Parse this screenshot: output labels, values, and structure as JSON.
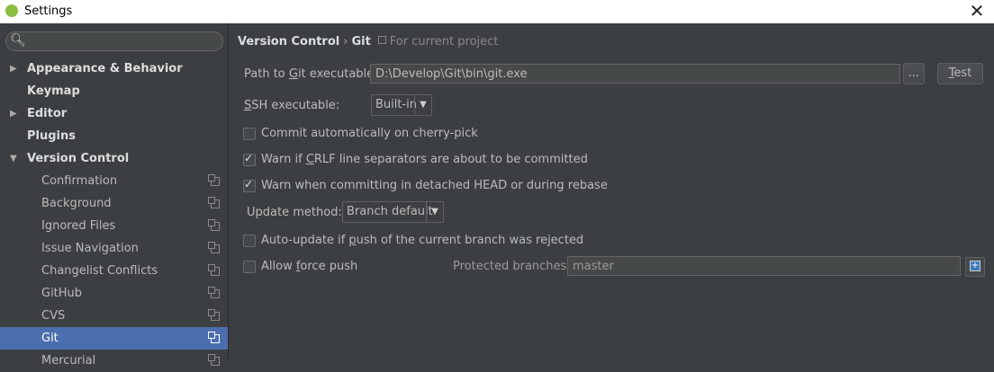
{
  "window": {
    "title": "Settings"
  },
  "sidebar": {
    "search_placeholder": "",
    "items": [
      {
        "label": "Appearance & Behavior",
        "arrow": "▶"
      },
      {
        "label": "Keymap",
        "arrow": ""
      },
      {
        "label": "Editor",
        "arrow": "▶"
      },
      {
        "label": "Plugins",
        "arrow": ""
      },
      {
        "label": "Version Control",
        "arrow": "▼"
      },
      {
        "label": "Confirmation"
      },
      {
        "label": "Background"
      },
      {
        "label": "Ignored Files"
      },
      {
        "label": "Issue Navigation"
      },
      {
        "label": "Changelist Conflicts"
      },
      {
        "label": "GitHub"
      },
      {
        "label": "CVS"
      },
      {
        "label": "Git"
      },
      {
        "label": "Mercurial"
      }
    ]
  },
  "breadcrumb": {
    "part1": "Version Control",
    "separator": "›",
    "part2": "Git",
    "scope": "For current project"
  },
  "form": {
    "git_path": {
      "label_pre": "Path to ",
      "label_ul": "G",
      "label_post": "it executable:",
      "value": "D:\\Develop\\Git\\bin\\git.exe",
      "browse": "...",
      "test_ul": "T",
      "test_rest": "est"
    },
    "ssh": {
      "label_ul": "S",
      "label_post": "SH executable:",
      "value": "Built-in",
      "arrow": "▼"
    },
    "commit_auto": {
      "label": "Commit automatically on cherry-pick",
      "checked": false
    },
    "warn_crlf": {
      "label_pre": "Warn if ",
      "label_ul": "C",
      "label_post": "RLF line separators are about to be committed",
      "checked": true
    },
    "warn_detached": {
      "label": "Warn when committing in detached HEAD or during rebase",
      "checked": true
    },
    "update_method": {
      "label": "Update method:",
      "value": "Branch default",
      "arrow": "▼"
    },
    "auto_update": {
      "label_pre": "Auto-update if ",
      "label_ul": "p",
      "label_post": "ush of the current branch was rejected",
      "checked": false
    },
    "force_push": {
      "label_pre": "Allow ",
      "label_ul": "f",
      "label_post": "orce push",
      "checked": false
    },
    "protected": {
      "label": "Protected branches:",
      "value": "master"
    }
  }
}
